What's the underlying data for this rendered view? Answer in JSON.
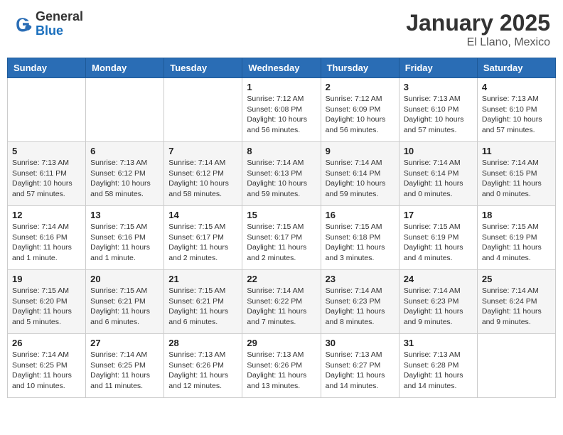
{
  "header": {
    "logo": {
      "general": "General",
      "blue": "Blue"
    },
    "title": "January 2025",
    "subtitle": "El Llano, Mexico"
  },
  "weekdays": [
    "Sunday",
    "Monday",
    "Tuesday",
    "Wednesday",
    "Thursday",
    "Friday",
    "Saturday"
  ],
  "weeks": [
    [
      {
        "day": null,
        "sunrise": null,
        "sunset": null,
        "daylight": null
      },
      {
        "day": null,
        "sunrise": null,
        "sunset": null,
        "daylight": null
      },
      {
        "day": null,
        "sunrise": null,
        "sunset": null,
        "daylight": null
      },
      {
        "day": "1",
        "sunrise": "Sunrise: 7:12 AM",
        "sunset": "Sunset: 6:08 PM",
        "daylight": "Daylight: 10 hours and 56 minutes."
      },
      {
        "day": "2",
        "sunrise": "Sunrise: 7:12 AM",
        "sunset": "Sunset: 6:09 PM",
        "daylight": "Daylight: 10 hours and 56 minutes."
      },
      {
        "day": "3",
        "sunrise": "Sunrise: 7:13 AM",
        "sunset": "Sunset: 6:10 PM",
        "daylight": "Daylight: 10 hours and 57 minutes."
      },
      {
        "day": "4",
        "sunrise": "Sunrise: 7:13 AM",
        "sunset": "Sunset: 6:10 PM",
        "daylight": "Daylight: 10 hours and 57 minutes."
      }
    ],
    [
      {
        "day": "5",
        "sunrise": "Sunrise: 7:13 AM",
        "sunset": "Sunset: 6:11 PM",
        "daylight": "Daylight: 10 hours and 57 minutes."
      },
      {
        "day": "6",
        "sunrise": "Sunrise: 7:13 AM",
        "sunset": "Sunset: 6:12 PM",
        "daylight": "Daylight: 10 hours and 58 minutes."
      },
      {
        "day": "7",
        "sunrise": "Sunrise: 7:14 AM",
        "sunset": "Sunset: 6:12 PM",
        "daylight": "Daylight: 10 hours and 58 minutes."
      },
      {
        "day": "8",
        "sunrise": "Sunrise: 7:14 AM",
        "sunset": "Sunset: 6:13 PM",
        "daylight": "Daylight: 10 hours and 59 minutes."
      },
      {
        "day": "9",
        "sunrise": "Sunrise: 7:14 AM",
        "sunset": "Sunset: 6:14 PM",
        "daylight": "Daylight: 10 hours and 59 minutes."
      },
      {
        "day": "10",
        "sunrise": "Sunrise: 7:14 AM",
        "sunset": "Sunset: 6:14 PM",
        "daylight": "Daylight: 11 hours and 0 minutes."
      },
      {
        "day": "11",
        "sunrise": "Sunrise: 7:14 AM",
        "sunset": "Sunset: 6:15 PM",
        "daylight": "Daylight: 11 hours and 0 minutes."
      }
    ],
    [
      {
        "day": "12",
        "sunrise": "Sunrise: 7:14 AM",
        "sunset": "Sunset: 6:16 PM",
        "daylight": "Daylight: 11 hours and 1 minute."
      },
      {
        "day": "13",
        "sunrise": "Sunrise: 7:15 AM",
        "sunset": "Sunset: 6:16 PM",
        "daylight": "Daylight: 11 hours and 1 minute."
      },
      {
        "day": "14",
        "sunrise": "Sunrise: 7:15 AM",
        "sunset": "Sunset: 6:17 PM",
        "daylight": "Daylight: 11 hours and 2 minutes."
      },
      {
        "day": "15",
        "sunrise": "Sunrise: 7:15 AM",
        "sunset": "Sunset: 6:17 PM",
        "daylight": "Daylight: 11 hours and 2 minutes."
      },
      {
        "day": "16",
        "sunrise": "Sunrise: 7:15 AM",
        "sunset": "Sunset: 6:18 PM",
        "daylight": "Daylight: 11 hours and 3 minutes."
      },
      {
        "day": "17",
        "sunrise": "Sunrise: 7:15 AM",
        "sunset": "Sunset: 6:19 PM",
        "daylight": "Daylight: 11 hours and 4 minutes."
      },
      {
        "day": "18",
        "sunrise": "Sunrise: 7:15 AM",
        "sunset": "Sunset: 6:19 PM",
        "daylight": "Daylight: 11 hours and 4 minutes."
      }
    ],
    [
      {
        "day": "19",
        "sunrise": "Sunrise: 7:15 AM",
        "sunset": "Sunset: 6:20 PM",
        "daylight": "Daylight: 11 hours and 5 minutes."
      },
      {
        "day": "20",
        "sunrise": "Sunrise: 7:15 AM",
        "sunset": "Sunset: 6:21 PM",
        "daylight": "Daylight: 11 hours and 6 minutes."
      },
      {
        "day": "21",
        "sunrise": "Sunrise: 7:15 AM",
        "sunset": "Sunset: 6:21 PM",
        "daylight": "Daylight: 11 hours and 6 minutes."
      },
      {
        "day": "22",
        "sunrise": "Sunrise: 7:14 AM",
        "sunset": "Sunset: 6:22 PM",
        "daylight": "Daylight: 11 hours and 7 minutes."
      },
      {
        "day": "23",
        "sunrise": "Sunrise: 7:14 AM",
        "sunset": "Sunset: 6:23 PM",
        "daylight": "Daylight: 11 hours and 8 minutes."
      },
      {
        "day": "24",
        "sunrise": "Sunrise: 7:14 AM",
        "sunset": "Sunset: 6:23 PM",
        "daylight": "Daylight: 11 hours and 9 minutes."
      },
      {
        "day": "25",
        "sunrise": "Sunrise: 7:14 AM",
        "sunset": "Sunset: 6:24 PM",
        "daylight": "Daylight: 11 hours and 9 minutes."
      }
    ],
    [
      {
        "day": "26",
        "sunrise": "Sunrise: 7:14 AM",
        "sunset": "Sunset: 6:25 PM",
        "daylight": "Daylight: 11 hours and 10 minutes."
      },
      {
        "day": "27",
        "sunrise": "Sunrise: 7:14 AM",
        "sunset": "Sunset: 6:25 PM",
        "daylight": "Daylight: 11 hours and 11 minutes."
      },
      {
        "day": "28",
        "sunrise": "Sunrise: 7:13 AM",
        "sunset": "Sunset: 6:26 PM",
        "daylight": "Daylight: 11 hours and 12 minutes."
      },
      {
        "day": "29",
        "sunrise": "Sunrise: 7:13 AM",
        "sunset": "Sunset: 6:26 PM",
        "daylight": "Daylight: 11 hours and 13 minutes."
      },
      {
        "day": "30",
        "sunrise": "Sunrise: 7:13 AM",
        "sunset": "Sunset: 6:27 PM",
        "daylight": "Daylight: 11 hours and 14 minutes."
      },
      {
        "day": "31",
        "sunrise": "Sunrise: 7:13 AM",
        "sunset": "Sunset: 6:28 PM",
        "daylight": "Daylight: 11 hours and 14 minutes."
      },
      {
        "day": null,
        "sunrise": null,
        "sunset": null,
        "daylight": null
      }
    ]
  ]
}
